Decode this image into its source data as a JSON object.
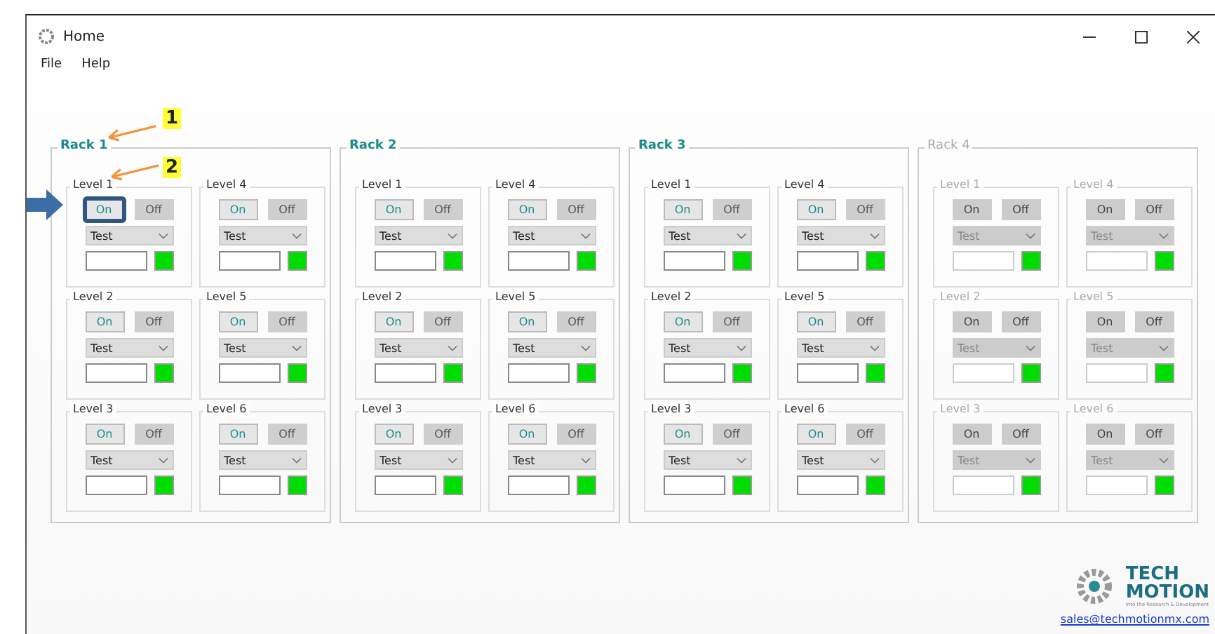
{
  "window": {
    "title": "Home"
  },
  "menu": [
    "File",
    "Help"
  ],
  "racks": [
    {
      "name": "Rack 1",
      "enabled": true,
      "levels": [
        {
          "name": "Level 1",
          "on": "On",
          "off": "Off",
          "mode": "Test",
          "highlighted": true,
          "color": "#00dd00"
        },
        {
          "name": "Level 2",
          "on": "On",
          "off": "Off",
          "mode": "Test",
          "highlighted": false,
          "color": "#00dd00"
        },
        {
          "name": "Level 3",
          "on": "On",
          "off": "Off",
          "mode": "Test",
          "highlighted": false,
          "color": "#00dd00"
        },
        {
          "name": "Level 4",
          "on": "On",
          "off": "Off",
          "mode": "Test",
          "highlighted": false,
          "color": "#00dd00"
        },
        {
          "name": "Level 5",
          "on": "On",
          "off": "Off",
          "mode": "Test",
          "highlighted": false,
          "color": "#00dd00"
        },
        {
          "name": "Level 6",
          "on": "On",
          "off": "Off",
          "mode": "Test",
          "highlighted": false,
          "color": "#00dd00"
        }
      ]
    },
    {
      "name": "Rack 2",
      "enabled": true,
      "levels": [
        {
          "name": "Level 1",
          "on": "On",
          "off": "Off",
          "mode": "Test",
          "highlighted": false,
          "color": "#00dd00"
        },
        {
          "name": "Level 2",
          "on": "On",
          "off": "Off",
          "mode": "Test",
          "highlighted": false,
          "color": "#00dd00"
        },
        {
          "name": "Level 3",
          "on": "On",
          "off": "Off",
          "mode": "Test",
          "highlighted": false,
          "color": "#00dd00"
        },
        {
          "name": "Level 4",
          "on": "On",
          "off": "Off",
          "mode": "Test",
          "highlighted": false,
          "color": "#00dd00"
        },
        {
          "name": "Level 5",
          "on": "On",
          "off": "Off",
          "mode": "Test",
          "highlighted": false,
          "color": "#00dd00"
        },
        {
          "name": "Level 6",
          "on": "On",
          "off": "Off",
          "mode": "Test",
          "highlighted": false,
          "color": "#00dd00"
        }
      ]
    },
    {
      "name": "Rack 3",
      "enabled": true,
      "levels": [
        {
          "name": "Level 1",
          "on": "On",
          "off": "Off",
          "mode": "Test",
          "highlighted": false,
          "color": "#00dd00"
        },
        {
          "name": "Level 2",
          "on": "On",
          "off": "Off",
          "mode": "Test",
          "highlighted": false,
          "color": "#00dd00"
        },
        {
          "name": "Level 3",
          "on": "On",
          "off": "Off",
          "mode": "Test",
          "highlighted": false,
          "color": "#00dd00"
        },
        {
          "name": "Level 4",
          "on": "On",
          "off": "Off",
          "mode": "Test",
          "highlighted": false,
          "color": "#00dd00"
        },
        {
          "name": "Level 5",
          "on": "On",
          "off": "Off",
          "mode": "Test",
          "highlighted": false,
          "color": "#00dd00"
        },
        {
          "name": "Level 6",
          "on": "On",
          "off": "Off",
          "mode": "Test",
          "highlighted": false,
          "color": "#00dd00"
        }
      ]
    },
    {
      "name": "Rack 4",
      "enabled": false,
      "levels": [
        {
          "name": "Level 1",
          "on": "On",
          "off": "Off",
          "mode": "Test",
          "highlighted": false,
          "color": "#00dd00"
        },
        {
          "name": "Level 2",
          "on": "On",
          "off": "Off",
          "mode": "Test",
          "highlighted": false,
          "color": "#00dd00"
        },
        {
          "name": "Level 3",
          "on": "On",
          "off": "Off",
          "mode": "Test",
          "highlighted": false,
          "color": "#00dd00"
        },
        {
          "name": "Level 4",
          "on": "On",
          "off": "Off",
          "mode": "Test",
          "highlighted": false,
          "color": "#00dd00"
        },
        {
          "name": "Level 5",
          "on": "On",
          "off": "Off",
          "mode": "Test",
          "highlighted": false,
          "color": "#00dd00"
        },
        {
          "name": "Level 6",
          "on": "On",
          "off": "Off",
          "mode": "Test",
          "highlighted": false,
          "color": "#00dd00"
        }
      ]
    }
  ],
  "annotations": [
    {
      "label": "1"
    },
    {
      "label": "2"
    }
  ],
  "logo": {
    "line_1": "TECH",
    "line_2": "MOTION",
    "tagline": "Into the Research & Development"
  },
  "email": "sales@techmotionmx.com"
}
